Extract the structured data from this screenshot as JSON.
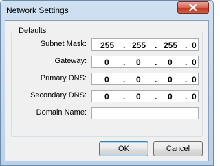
{
  "window": {
    "title": "Network Settings",
    "close_icon": "close-icon"
  },
  "group": {
    "label": "Defaults"
  },
  "fields": {
    "subnet_mask": {
      "label": "Subnet Mask:",
      "octets": [
        "255",
        "255",
        "255",
        "0"
      ]
    },
    "gateway": {
      "label": "Gateway:",
      "octets": [
        "0",
        "0",
        "0",
        "0"
      ]
    },
    "primary_dns": {
      "label": "Primary DNS:",
      "octets": [
        "0",
        "0",
        "0",
        "0"
      ]
    },
    "secondary_dns": {
      "label": "Secondary DNS:",
      "octets": [
        "0",
        "0",
        "0",
        "0"
      ]
    },
    "domain_name": {
      "label": "Domain Name:",
      "value": ""
    }
  },
  "dot": ".",
  "buttons": {
    "ok": "OK",
    "cancel": "Cancel"
  }
}
